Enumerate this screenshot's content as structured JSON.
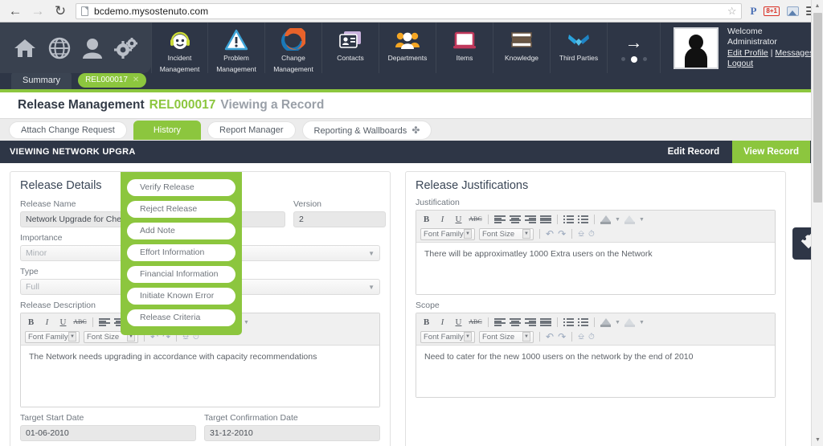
{
  "browser": {
    "back_icon": "back-arrow-icon",
    "forward_icon": "forward-arrow-icon",
    "reload_icon": "reload-icon",
    "url": "bcdemo.mysostenuto.com",
    "star_icon": "bookmark-star-icon",
    "extensions": [
      {
        "name": "pocket-extension-icon",
        "label": "P"
      },
      {
        "name": "google-plus-icon",
        "label": "8+1"
      },
      {
        "name": "image-extension-icon",
        "label": ""
      }
    ],
    "menu_icon": "hamburger-menu-icon"
  },
  "topnav": {
    "quick_icons": [
      {
        "name": "home-icon",
        "glyph": "⌂"
      },
      {
        "name": "globe-icon",
        "glyph": "ἱ0"
      },
      {
        "name": "user-icon",
        "glyph": "὆4"
      },
      {
        "name": "settings-gears-icon",
        "glyph": "⚙"
      }
    ],
    "modules": [
      {
        "name": "incident-management",
        "line1": "Incident",
        "line2": "Management",
        "icon": "agent-headset-icon"
      },
      {
        "name": "problem-management",
        "line1": "Problem",
        "line2": "Management",
        "icon": "warning-triangle-icon"
      },
      {
        "name": "change-management",
        "line1": "Change",
        "line2": "Management",
        "icon": "refresh-cycle-icon"
      },
      {
        "name": "contacts",
        "line1": "Contacts",
        "line2": "",
        "icon": "contact-card-icon"
      },
      {
        "name": "departments",
        "line1": "Departments",
        "line2": "",
        "icon": "people-group-icon"
      },
      {
        "name": "items",
        "line1": "Items",
        "line2": "",
        "icon": "laptop-icon"
      },
      {
        "name": "knowledge",
        "line1": "Knowledge",
        "line2": "",
        "icon": "books-stack-icon"
      },
      {
        "name": "third-parties",
        "line1": "Third Parties",
        "line2": "",
        "icon": "handshake-icon"
      }
    ],
    "next_arrow": "→",
    "carousel_dots": 3,
    "carousel_active_index": 1
  },
  "user": {
    "welcome": "Welcome",
    "name": "Administrator",
    "edit_profile": "Edit Profile",
    "separator": "|",
    "messages": "Messages",
    "logout": "Logout",
    "avatar": "user-avatar-silhouette"
  },
  "tabs": {
    "summary": "Summary",
    "record_pill": "REL000017",
    "record_pill_close": "✕"
  },
  "page": {
    "title": "Release Management",
    "record_code": "REL000017",
    "subtitle": "Viewing a Record"
  },
  "toolbar": {
    "buttons": [
      {
        "name": "attach-change-request-button",
        "label": "Attach Change Request",
        "active": false
      },
      {
        "name": "history-button",
        "label": "History",
        "active": true
      },
      {
        "name": "report-manager-button",
        "label": "Report Manager",
        "active": false
      },
      {
        "name": "reporting-wallboards-button",
        "label": "Reporting & Wallboards",
        "active": false,
        "plus": "✤"
      }
    ]
  },
  "history_menu": {
    "items": [
      "Verify Release",
      "Reject Release",
      "Add Note",
      "Effort Information",
      "Financial Information",
      "Initiate Known Error",
      "Release Criteria"
    ]
  },
  "viewbar": {
    "title": "VIEWING NETWORK UPGRA",
    "edit_record": "Edit Record",
    "view_record": "View Record"
  },
  "release_details": {
    "heading": "Release Details",
    "fields": {
      "release_name_label": "Release Name",
      "release_name_value": "Network Upgrade for Chessingto",
      "version_label": "Version",
      "version_value": "2",
      "importance_label": "Importance",
      "importance_value": "Minor",
      "type_label": "Type",
      "type_value": "Full",
      "description_label": "Release Description",
      "description_value": "The Network needs upgrading in accordance with capacity recommendations",
      "target_start_label": "Target Start Date",
      "target_start_value": "01-06-2010",
      "target_confirmation_label": "Target Confirmation Date",
      "target_confirmation_value": "31-12-2010"
    }
  },
  "release_justifications": {
    "heading": "Release Justifications",
    "justification_label": "Justification",
    "justification_value": "There will be approximatley 1000 Extra users on the Network",
    "scope_label": "Scope",
    "scope_value": "Need to cater for the new 1000 users on the network by the end of 2010"
  },
  "rte": {
    "bold": "B",
    "italic": "I",
    "underline": "U",
    "strike": "ABC",
    "font_family_placeholder": "Font Family",
    "font_size_placeholder": "Font Size",
    "undo_icon": "undo-icon",
    "redo_icon": "redo-icon",
    "paste_icon": "paste-word-icon",
    "clock_icon": "insert-time-icon",
    "align_left_icon": "align-left-icon",
    "align_center_icon": "align-center-icon",
    "align_right_icon": "align-right-icon",
    "align_justify_icon": "align-justify-icon",
    "bullet_list_icon": "bullet-list-icon",
    "numbered_list_icon": "numbered-list-icon",
    "text_color_icon": "text-color-icon",
    "highlight_color_icon": "highlight-color-icon"
  },
  "fab": {
    "name": "tags-icon",
    "label": "tags"
  },
  "colors": {
    "brand_green": "#8cc63e",
    "dark_navy": "#2e3646",
    "panel_border": "#e0e0e0"
  }
}
